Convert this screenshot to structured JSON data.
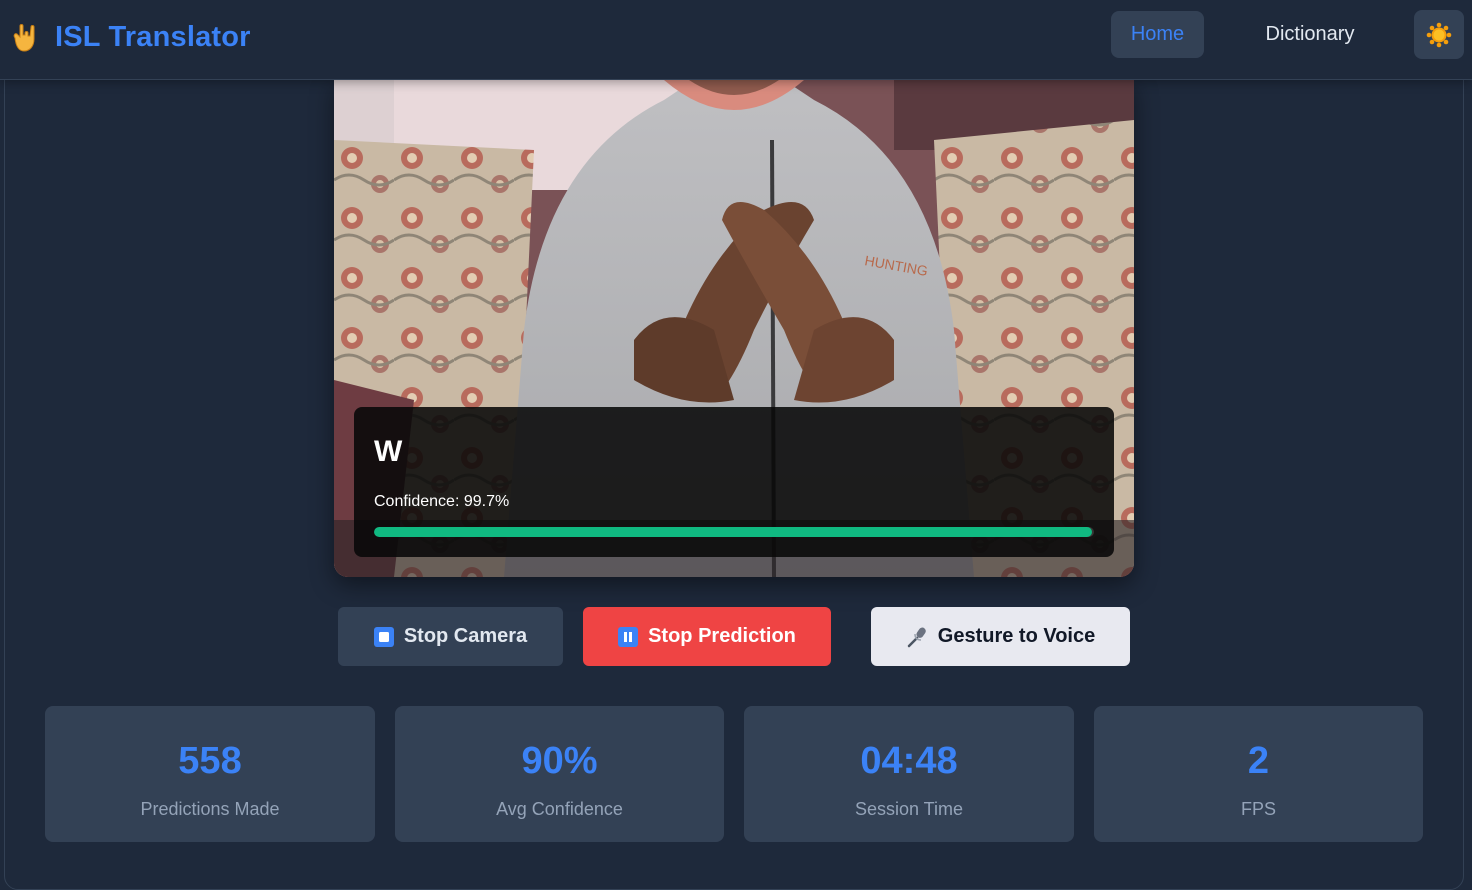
{
  "header": {
    "brand_icon": "hand-sign-icon",
    "title": "ISL Translator",
    "nav": [
      {
        "label": "Home",
        "active": true
      },
      {
        "label": "Dictionary",
        "active": false
      }
    ],
    "theme_icon": "sun-icon"
  },
  "prediction": {
    "letter": "W",
    "confidence_label": "Confidence: ",
    "confidence_text": "99.7%",
    "confidence_value": 99.7
  },
  "controls": {
    "stop_camera": {
      "label": "Stop Camera",
      "icon": "stop-square-icon"
    },
    "stop_prediction": {
      "label": "Stop Prediction",
      "icon": "pause-icon"
    },
    "gesture_to_voice": {
      "label": "Gesture to Voice",
      "icon": "microphone-icon"
    }
  },
  "stats": [
    {
      "value": "558",
      "label": "Predictions Made"
    },
    {
      "value": "90%",
      "label": "Avg Confidence"
    },
    {
      "value": "04:48",
      "label": "Session Time"
    },
    {
      "value": "2",
      "label": "FPS"
    }
  ],
  "colors": {
    "background": "#1e293b",
    "card": "#334155",
    "accent": "#3b82f6",
    "danger": "#ef4444",
    "success": "#10b981"
  }
}
